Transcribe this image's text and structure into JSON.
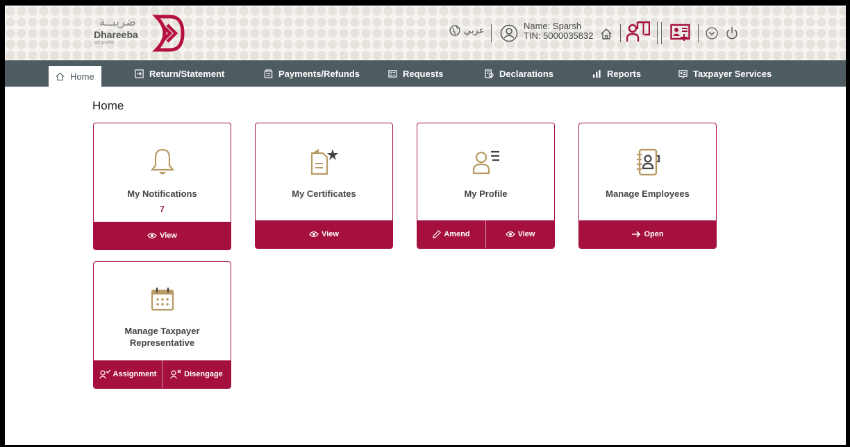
{
  "header": {
    "logo": {
      "arabic": "ضريبــة",
      "name": "Dhareeba",
      "sub": "tax portal"
    },
    "language_label": "عربي",
    "user": {
      "name_line": "Name: Sparsh",
      "tin_line": "TIN: 5000035832"
    }
  },
  "nav": {
    "items": [
      {
        "label": "Home",
        "icon": "home-icon"
      },
      {
        "label": "Return/Statement",
        "icon": "return-icon"
      },
      {
        "label": "Payments/Refunds",
        "icon": "payments-icon"
      },
      {
        "label": "Requests",
        "icon": "requests-icon"
      },
      {
        "label": "Declarations",
        "icon": "declarations-icon"
      },
      {
        "label": "Reports",
        "icon": "bar-chart-icon"
      },
      {
        "label": "Taxpayer Services",
        "icon": "services-icon"
      }
    ]
  },
  "page": {
    "title": "Home"
  },
  "cards": {
    "notifications": {
      "title": "My Notifications",
      "count": "7",
      "actions": [
        "View"
      ]
    },
    "certificates": {
      "title": "My Certificates",
      "actions": [
        "View"
      ]
    },
    "profile": {
      "title": "My Profile",
      "actions": [
        "Amend",
        "View"
      ]
    },
    "employees": {
      "title": "Manage Employees",
      "actions": [
        "Open"
      ]
    },
    "representative": {
      "title_line1": "Manage Taxpayer",
      "title_line2": "Representative",
      "actions": [
        "Assignment",
        "Disengage"
      ]
    }
  },
  "colors": {
    "accent": "#a5103f",
    "gold": "#b89b64",
    "nav_bg": "#4e5b61"
  }
}
